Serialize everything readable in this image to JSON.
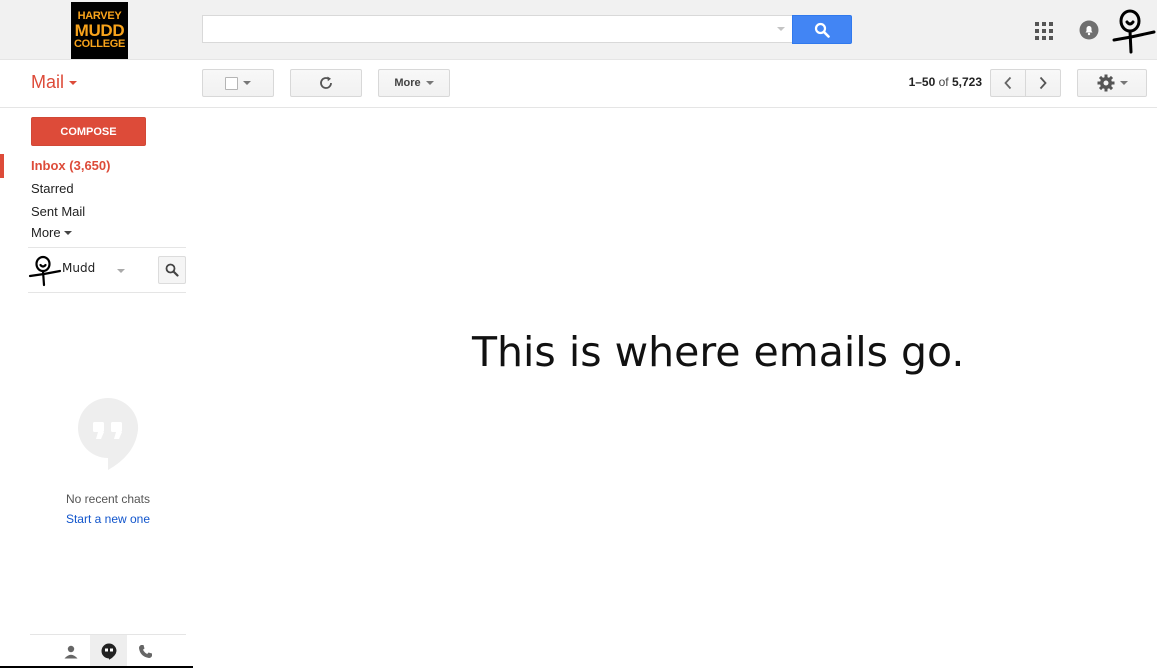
{
  "header": {
    "logo": {
      "line1": "HARVEY",
      "line2": "MUDD",
      "line3": "COLLEGE"
    },
    "search": {
      "value": "",
      "placeholder": ""
    }
  },
  "toolbar": {
    "mail_label": "Mail",
    "more_label": "More",
    "pagination": {
      "range": "1–50",
      "of": "of",
      "total": "5,723"
    }
  },
  "sidebar": {
    "compose_label": "COMPOSE",
    "items": [
      {
        "label": "Inbox (3,650)",
        "active": true
      },
      {
        "label": "Starred"
      },
      {
        "label": "Sent Mail"
      },
      {
        "label": "More"
      }
    ],
    "chat": {
      "user_name": "Mudd",
      "no_chats": "No recent chats",
      "start_new": "Start a new one"
    }
  },
  "main": {
    "message": "This is where emails go."
  },
  "colors": {
    "accent_red": "#dd4b39",
    "search_blue": "#4285f4",
    "link_blue": "#1155cc",
    "logo_orange": "#f8a31b"
  }
}
